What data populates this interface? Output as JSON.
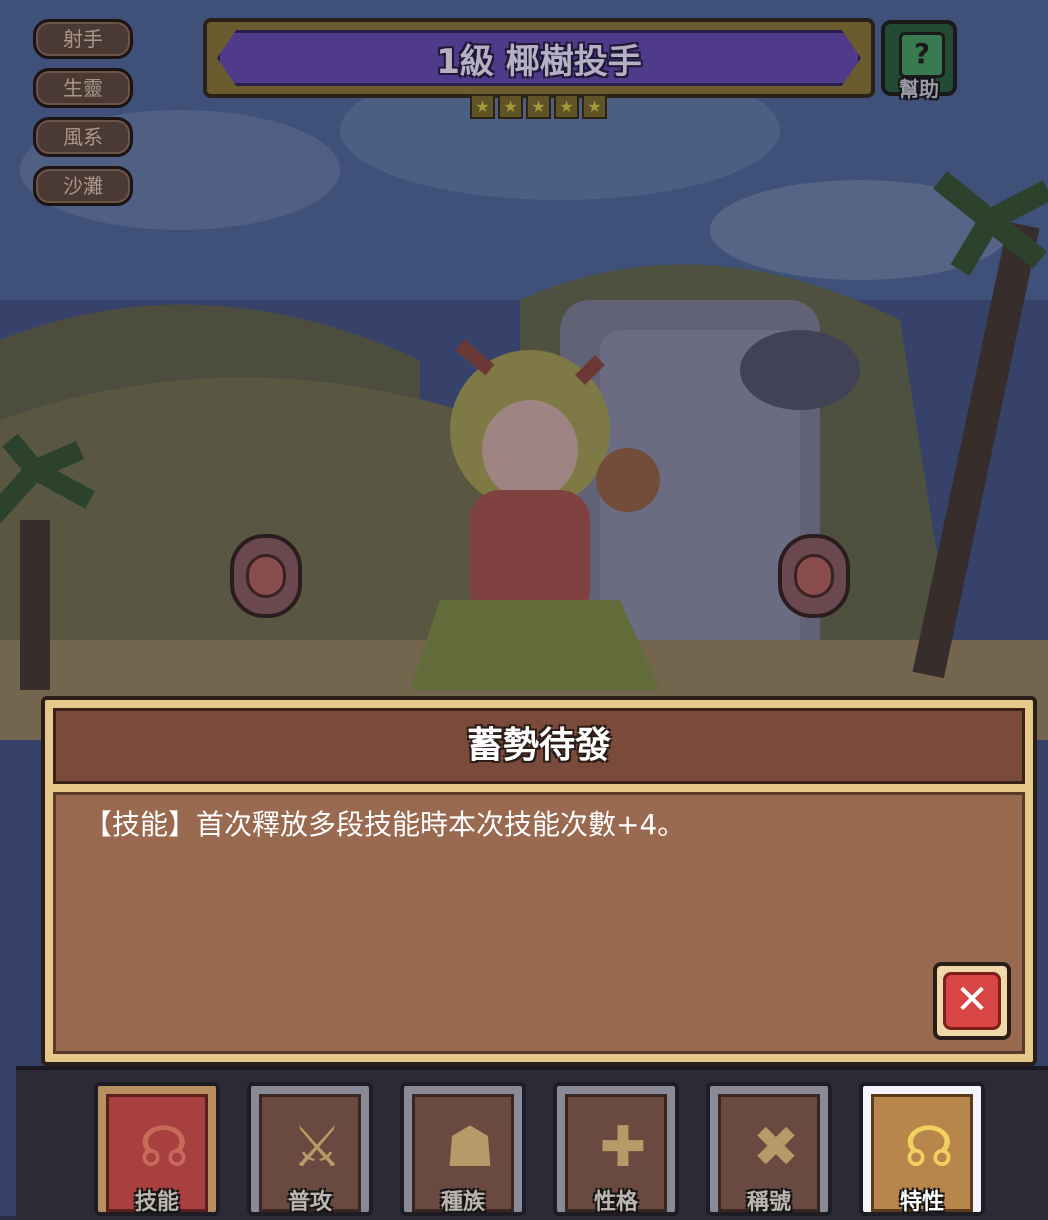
{
  "tags": [
    "射手",
    "生靈",
    "風系",
    "沙灘"
  ],
  "title": "1級 椰樹投手",
  "stars": [
    "★",
    "★",
    "★",
    "★",
    "★"
  ],
  "help": {
    "symbol": "?",
    "label": "幫助"
  },
  "dialog": {
    "title": "蓄勢待發",
    "description": "【技能】首次釋放多段技能時本次技能次數+4。",
    "close_symbol": "✕"
  },
  "tabs": [
    {
      "label": "技能",
      "icon": "skill-emblem-icon",
      "glyph": "☊"
    },
    {
      "label": "普攻",
      "icon": "sword-icon",
      "glyph": "⚔"
    },
    {
      "label": "種族",
      "icon": "mushroom-icon",
      "glyph": "☗"
    },
    {
      "label": "性格",
      "icon": "cross-icon",
      "glyph": "✚"
    },
    {
      "label": "稱號",
      "icon": "crossed-swords-icon",
      "glyph": "✖"
    },
    {
      "label": "特性",
      "icon": "trait-emblem-icon",
      "glyph": "☊"
    }
  ],
  "colors": {
    "dialog_header": "#7a4a3a",
    "dialog_body": "#9a6a50",
    "title_bar": "#4f3b8a",
    "close_button": "#d84545"
  }
}
